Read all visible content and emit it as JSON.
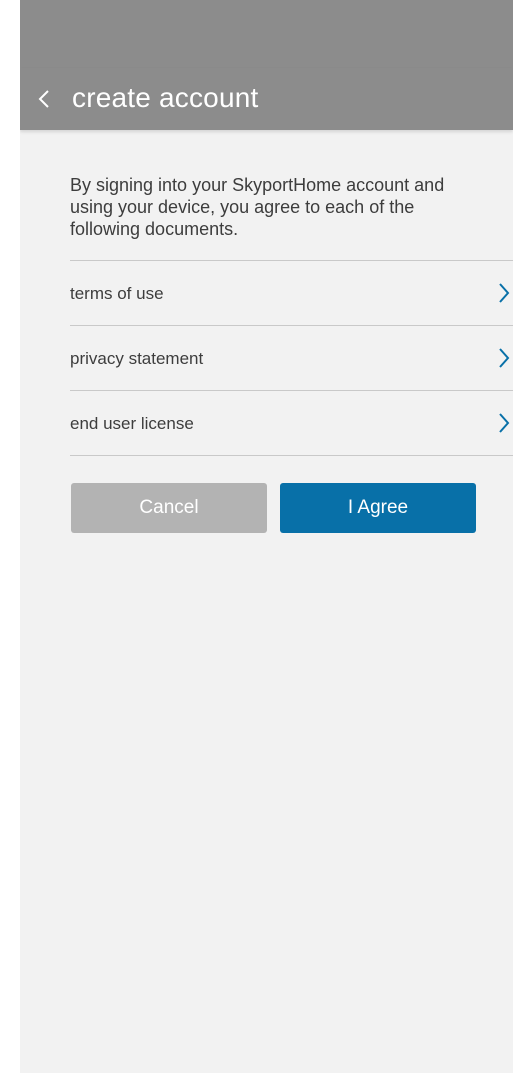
{
  "header": {
    "title": "create account",
    "back_icon": "chevron-left-icon"
  },
  "intro": {
    "text": "By signing into your SkyportHome account and using your device, you agree to each of the following documents."
  },
  "documents": [
    {
      "label": "terms of use",
      "icon": "chevron-right-icon"
    },
    {
      "label": "privacy statement",
      "icon": "chevron-right-icon"
    },
    {
      "label": "end user license",
      "icon": "chevron-right-icon"
    }
  ],
  "actions": {
    "cancel_label": "Cancel",
    "agree_label": "I Agree"
  },
  "colors": {
    "app_bar": "#8c8c8c",
    "background": "#f2f2f2",
    "accent": "#0870a8",
    "cancel": "#b3b3b3"
  }
}
